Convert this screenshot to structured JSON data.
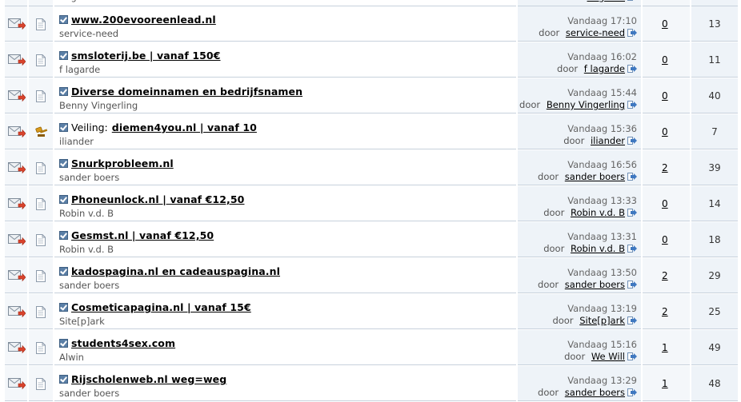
{
  "prefix_label": "door",
  "rows": [
    {
      "title": "",
      "author": "Rogover",
      "date": "",
      "user": "Rogover",
      "replies": "",
      "views": "",
      "icon": "doc-icon",
      "partial": true
    },
    {
      "prefix": "",
      "title": "www.200evooreenlead.nl",
      "author": "service-need",
      "date": "Vandaag 17:10",
      "user": "service-need",
      "replies": "0",
      "views": "13",
      "icon": "doc-icon"
    },
    {
      "prefix": "",
      "title": "smsloterij.be | vanaf 150€",
      "author": "f lagarde",
      "date": "Vandaag 16:02",
      "user": "f lagarde",
      "replies": "0",
      "views": "11",
      "icon": "doc-icon"
    },
    {
      "prefix": "",
      "title": "Diverse domeinnamen en bedrijfsnamen",
      "author": "Benny Vingerling",
      "date": "Vandaag 15:44",
      "user": "Benny Vingerling",
      "replies": "0",
      "views": "40",
      "icon": "doc-icon"
    },
    {
      "prefix": "Veiling:",
      "title": "diemen4you.nl | vanaf 10",
      "author": "iliander",
      "date": "Vandaag 15:36",
      "user": "iliander",
      "replies": "0",
      "views": "7",
      "icon": "gavel-icon"
    },
    {
      "prefix": "",
      "title": "Snurkprobleem.nl",
      "author": "sander boers",
      "date": "Vandaag 16:56",
      "user": "sander boers",
      "replies": "2",
      "views": "39",
      "icon": "doc-icon"
    },
    {
      "prefix": "",
      "title": "Phoneunlock.nl | vanaf €12,50",
      "author": "Robin v.d. B",
      "date": "Vandaag 13:33",
      "user": "Robin v.d. B",
      "replies": "0",
      "views": "14",
      "icon": "doc-icon"
    },
    {
      "prefix": "",
      "title": "Gesmst.nl | vanaf €12,50",
      "author": "Robin v.d. B",
      "date": "Vandaag 13:31",
      "user": "Robin v.d. B",
      "replies": "0",
      "views": "18",
      "icon": "doc-icon"
    },
    {
      "prefix": "",
      "title": "kadospagina.nl en cadeauspagina.nl",
      "author": "sander boers",
      "date": "Vandaag 13:50",
      "user": "sander boers",
      "replies": "2",
      "views": "29",
      "icon": "doc-icon"
    },
    {
      "prefix": "",
      "title": "Cosmeticapagina.nl | vanaf 15€",
      "author": "Site[p]ark",
      "date": "Vandaag 13:19",
      "user": "Site[p]ark",
      "replies": "2",
      "views": "25",
      "icon": "doc-icon"
    },
    {
      "prefix": "",
      "title": "students4sex.com",
      "author": "Alwin",
      "date": "Vandaag 15:16",
      "user": "We Will",
      "replies": "1",
      "views": "49",
      "icon": "doc-icon"
    },
    {
      "prefix": "",
      "title": "Rijscholenweb.nl weg=weg",
      "author": "sander boers",
      "date": "Vandaag 13:29",
      "user": "sander boers",
      "replies": "1",
      "views": "48",
      "icon": "doc-icon"
    }
  ]
}
